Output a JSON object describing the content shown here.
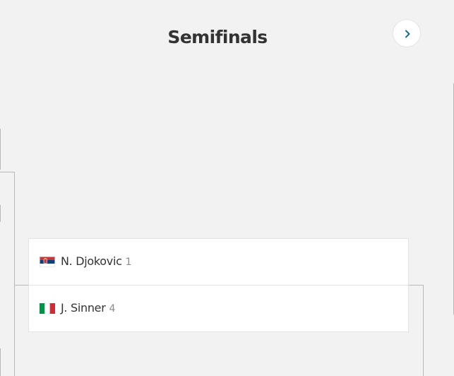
{
  "round": {
    "title": "Semifinals"
  },
  "navigation": {
    "next_icon": "chevron-right-icon",
    "icon_color": "#1a6e8a"
  },
  "match": {
    "players": [
      {
        "name": "N. Djokovic",
        "seed": "1",
        "flag_icon": "serbia-flag-icon"
      },
      {
        "name": "J. Sinner",
        "seed": "4",
        "flag_icon": "italy-flag-icon"
      }
    ]
  }
}
